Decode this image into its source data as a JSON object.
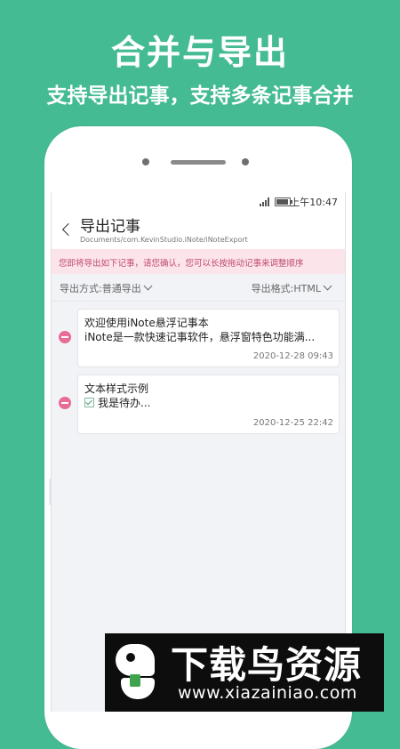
{
  "promo": {
    "title": "合并与导出",
    "subtitle": "支持导出记事，支持多条记事合并"
  },
  "status_bar": {
    "time": "上午10:47"
  },
  "header": {
    "title": "导出记事",
    "path": "Documents/com.KevinStudio.iNote/iNoteExport"
  },
  "notice": {
    "text": "您即将导出如下记事，请您确认，您可以长按拖动记事来调整顺序"
  },
  "options": {
    "export_method": "导出方式:普通导出",
    "export_format": "导出格式:HTML"
  },
  "notes": [
    {
      "title": "欢迎使用iNote悬浮记事本",
      "preview": "iNote是一款快速记事软件，悬浮窗特色功能满...",
      "date": "2020-12-28 09:43"
    },
    {
      "title": "文本样式示例",
      "preview": "我是待办...",
      "date": "2020-12-25 22:42"
    }
  ],
  "watermark": {
    "name": "下载鸟资源",
    "url": "www.xiazainiao.com"
  },
  "colors": {
    "background": "#45bb93",
    "notice_bg": "#fbe4ea",
    "remove": "#e86c93"
  }
}
